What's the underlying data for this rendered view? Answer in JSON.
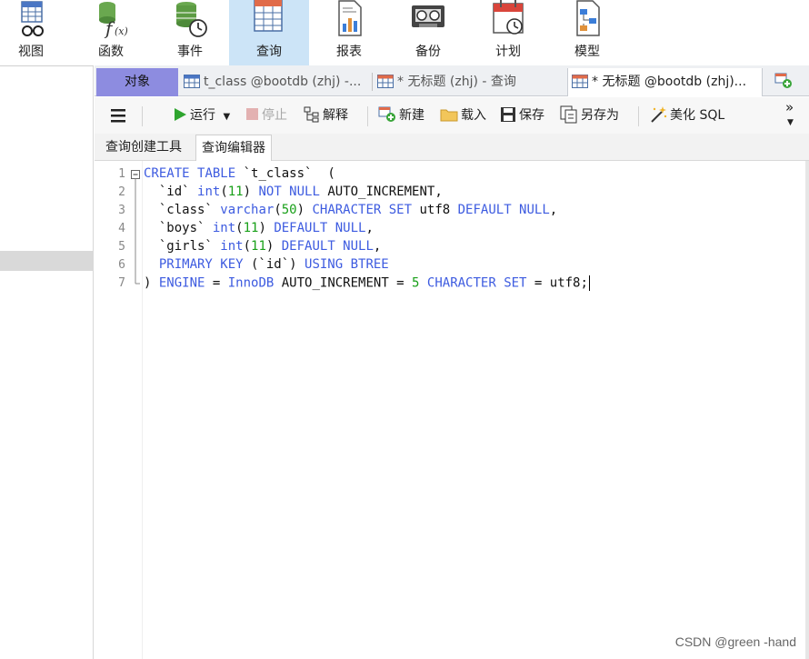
{
  "ribbon": {
    "items": [
      {
        "label": "视图",
        "icon": "view-icon"
      },
      {
        "label": "函数",
        "icon": "function-icon"
      },
      {
        "label": "事件",
        "icon": "event-icon"
      },
      {
        "label": "查询",
        "icon": "query-icon",
        "active": true
      },
      {
        "label": "报表",
        "icon": "report-icon"
      },
      {
        "label": "备份",
        "icon": "backup-icon"
      },
      {
        "label": "计划",
        "icon": "schedule-icon"
      },
      {
        "label": "模型",
        "icon": "model-icon"
      }
    ]
  },
  "tabs": {
    "objects": "对象",
    "tab1": "t_class @bootdb (zhj) -...",
    "tab2": "* 无标题 (zhj) - 查询",
    "tab3": "* 无标题 @bootdb (zhj)...",
    "new_tab_icon": "new-tab-icon"
  },
  "toolbar": {
    "run": "运行",
    "stop": "停止",
    "explain": "解释",
    "new": "新建",
    "load": "载入",
    "save": "保存",
    "save_as": "另存为",
    "beautify": "美化 SQL",
    "more": "»"
  },
  "subtabs": {
    "builder": "查询创建工具",
    "editor": "查询编辑器"
  },
  "editor": {
    "line_numbers": [
      "1",
      "2",
      "3",
      "4",
      "5",
      "6",
      "7"
    ]
  },
  "colors": {
    "keyword": "#3d5be0",
    "number": "#19a019",
    "active_ribbon": "#cce4f7",
    "objects_tab": "#8d8ce0"
  },
  "watermark": "CSDN @green -hand"
}
